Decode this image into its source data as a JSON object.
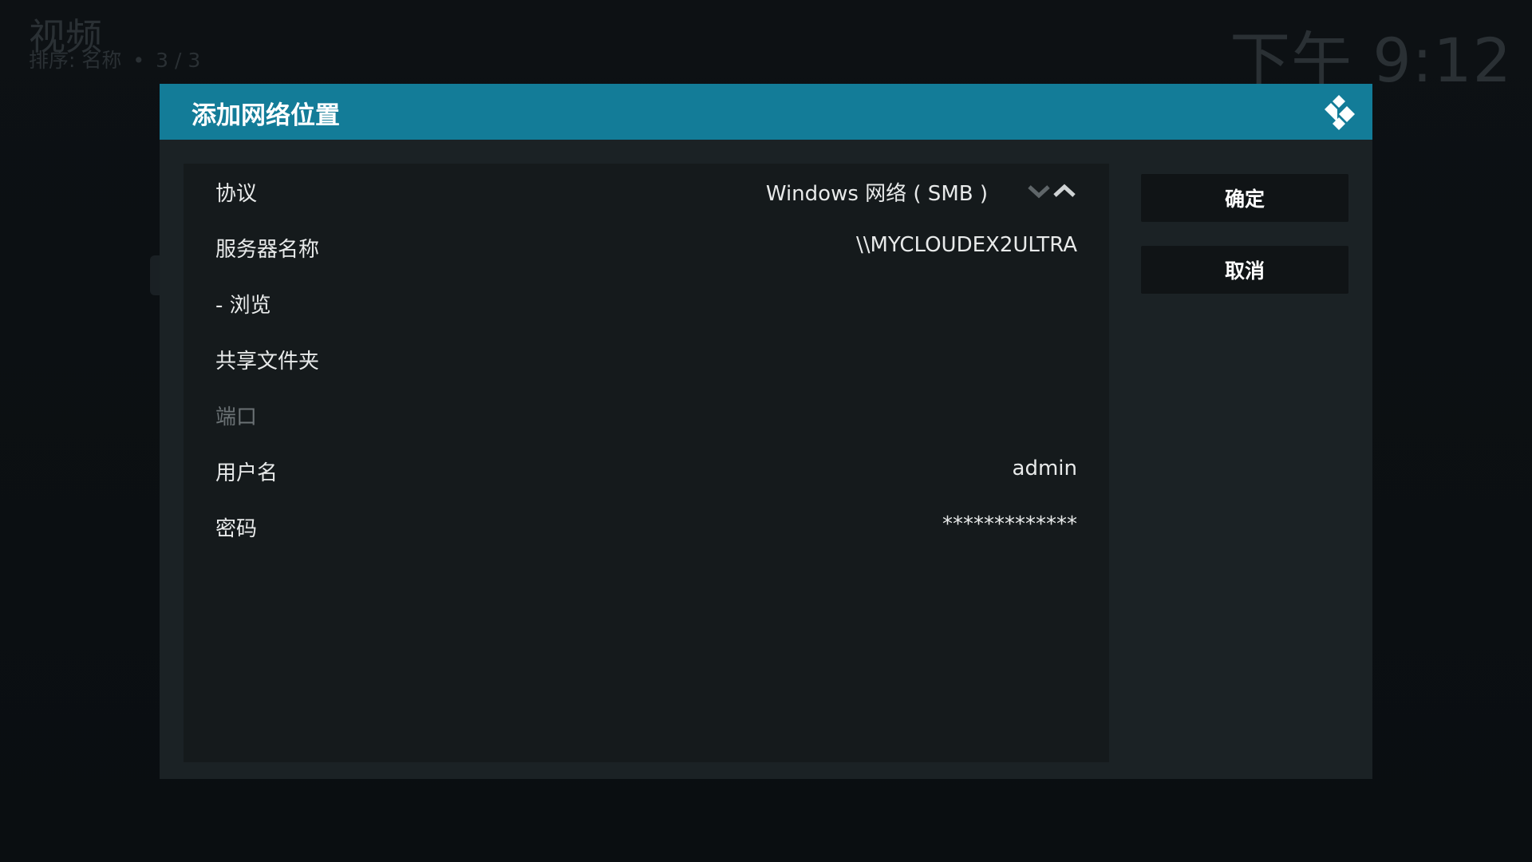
{
  "background": {
    "window_title": "视频",
    "sort_label": "排序: 名称",
    "separator": "•",
    "item_count": "3 / 3",
    "clock": "下午 9:12"
  },
  "dialog": {
    "title": "添加网络位置",
    "logo_icon": "kodi-logo-icon",
    "header_color": "#137c98",
    "rows": [
      {
        "label": "协议",
        "value": "Windows 网络 ( SMB )",
        "has_spinner": true,
        "enabled": true
      },
      {
        "label": "服务器名称",
        "value": "\\\\MYCLOUDEX2ULTRA",
        "has_spinner": false,
        "enabled": true
      },
      {
        "label": "- 浏览",
        "value": "",
        "has_spinner": false,
        "enabled": true
      },
      {
        "label": "共享文件夹",
        "value": "",
        "has_spinner": false,
        "enabled": true
      },
      {
        "label": "端口",
        "value": "",
        "has_spinner": false,
        "enabled": false
      },
      {
        "label": "用户名",
        "value": "admin",
        "has_spinner": false,
        "enabled": true
      },
      {
        "label": "密码",
        "value": "*************",
        "has_spinner": false,
        "enabled": true
      }
    ],
    "buttons": {
      "ok_label": "确定",
      "cancel_label": "取消"
    }
  }
}
